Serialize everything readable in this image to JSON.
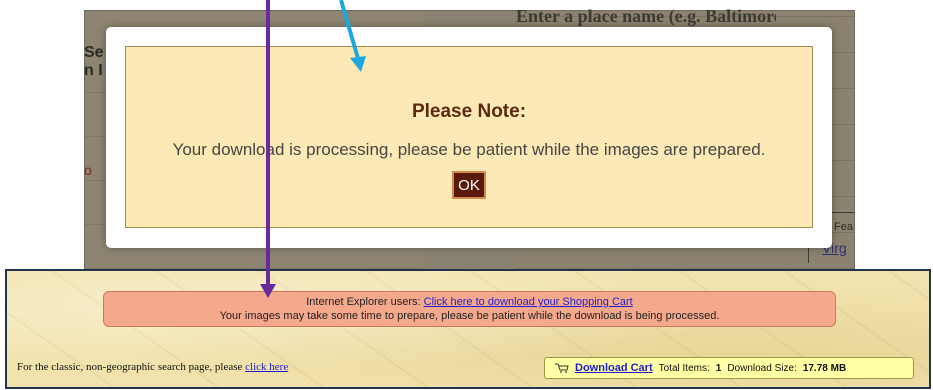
{
  "background": {
    "heading": "Enter a place name (e.g. Baltimore):",
    "left_fragment": "Se\nn I",
    "o_fragment": "o",
    "fea_fragment": "Fea",
    "link_fragment": "Virg"
  },
  "modal": {
    "title": "Please Note:",
    "message": "Your download is processing, please be patient while the images are prepared.",
    "ok_label": "OK"
  },
  "banner": {
    "line1_prefix": "Internet Explorer users: ",
    "line1_link": "Click here to download your Shopping Cart",
    "line2": "Your images may take some time to prepare, please be patient while the download is being processed."
  },
  "classic": {
    "text": "For the classic, non-geographic search page, please ",
    "link": "click here"
  },
  "cart": {
    "icon": "cart-icon",
    "link": "Download Cart",
    "items_label": "Total Items:",
    "items_value": "1",
    "size_label": "Download Size:",
    "size_value": "17.78 MB"
  },
  "colors": {
    "arrow_blue": "#1ea7df",
    "arrow_purple": "#6a2a9e",
    "modal_bg": "#fde9b5",
    "ok_bg": "#5a1a0b",
    "banner_bg": "#f4a88c",
    "cart_bg": "#ffffa5"
  }
}
